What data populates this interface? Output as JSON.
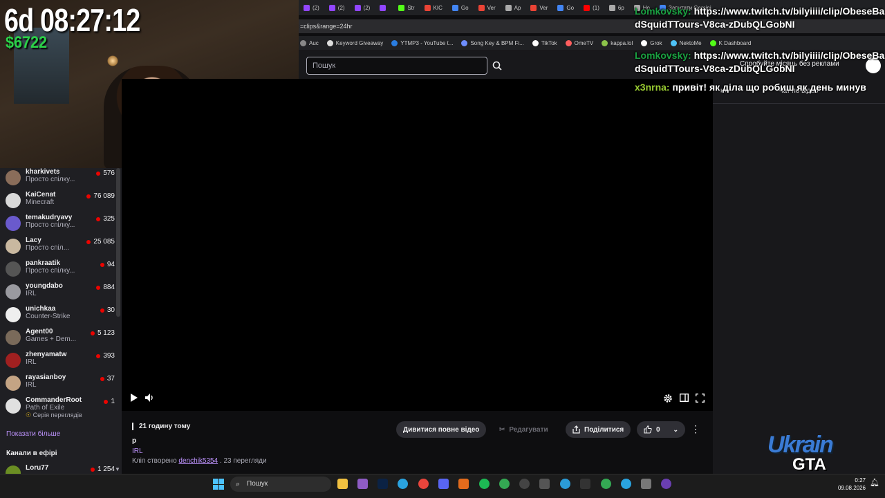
{
  "browser": {
    "tabs": [
      {
        "label": "(2)",
        "color": "#9146ff"
      },
      {
        "label": "(2)",
        "color": "#9146ff"
      },
      {
        "label": "(2)",
        "color": "#9146ff"
      },
      {
        "label": "",
        "color": "#9146ff"
      },
      {
        "label": "Str",
        "color": "#53fc18"
      },
      {
        "label": "KIC",
        "color": "#ea4335"
      },
      {
        "label": "Go",
        "color": "#4285f4"
      },
      {
        "label": "Ver",
        "color": "#ea4335"
      },
      {
        "label": "Ap",
        "color": "#aaaaaa"
      },
      {
        "label": "Ver",
        "color": "#ea4335"
      },
      {
        "label": "Go",
        "color": "#4285f4"
      },
      {
        "label": "(1)",
        "color": "#ff0000"
      },
      {
        "label": "6p",
        "color": "#aaaaaa"
      },
      {
        "label": "Ho",
        "color": "#aaaaaa"
      },
      {
        "label": "Запитати Gemini",
        "color": "#4285f4"
      }
    ],
    "address": "=clips&range=24hr",
    "bookmarks": [
      {
        "label": "Auc",
        "color": "#888888"
      },
      {
        "label": "Keyword Giveaway",
        "color": "#dddddd"
      },
      {
        "label": "YTMP3 - YouTube t...",
        "color": "#2a7de1"
      },
      {
        "label": "Song Key & BPM Fi...",
        "color": "#6e8eff"
      },
      {
        "label": "TikTok",
        "color": "#ffffff"
      },
      {
        "label": "OmeTV",
        "color": "#ff5e5e"
      },
      {
        "label": "kappa.lol",
        "color": "#8bc34a"
      },
      {
        "label": "Grok",
        "color": "#ffffff"
      },
      {
        "label": "NektoMe",
        "color": "#4fc3f7"
      },
      {
        "label": "K Dashboard",
        "color": "#53fc18"
      }
    ]
  },
  "nav": {
    "search_placeholder": "Пошук",
    "turbo_text": "Спробуйте місяць без реклами"
  },
  "webcam": {
    "timer": "6d 08:27:12",
    "money": "$6722"
  },
  "sidebar": {
    "channels": [
      {
        "name": "kharkivets",
        "game": "Просто спілку...",
        "viewers": "576",
        "color": "#8a6d5a"
      },
      {
        "name": "KaiCenat",
        "game": "Minecraft",
        "viewers": "76 089",
        "color": "#d9d9d9"
      },
      {
        "name": "temakudryavy",
        "game": "Просто спілку...",
        "viewers": "325",
        "color": "#6a5acd"
      },
      {
        "name": "Lacy",
        "game": "Просто спіл...",
        "viewers": "25 085",
        "color": "#c9b8a0"
      },
      {
        "name": "pankraatik",
        "game": "Просто спілку...",
        "viewers": "94",
        "color": "#555555"
      },
      {
        "name": "youngdabo",
        "game": "IRL",
        "viewers": "884",
        "color": "#9a9aa0"
      },
      {
        "name": "unichkaa",
        "game": "Counter-Strike",
        "viewers": "30",
        "color": "#eeeeee"
      },
      {
        "name": "Agent00",
        "game": "Games + Dem...",
        "viewers": "5 123",
        "color": "#7a6a5a"
      },
      {
        "name": "zhenyamatw",
        "game": "IRL",
        "viewers": "393",
        "color": "#a02020"
      },
      {
        "name": "rayasianboy",
        "game": "IRL",
        "viewers": "37",
        "color": "#c4a484"
      },
      {
        "name": "CommanderRoot",
        "game": "Path of Exile",
        "viewers": "1",
        "color": "#e0e0e0",
        "extra": "Серія переглядів 2"
      }
    ],
    "show_more": "Показати більше",
    "live_section_title": "Канали в ефірі",
    "live_channel": {
      "name": "Loru77",
      "viewers": "1 254",
      "color": "#6b8e23"
    }
  },
  "clip": {
    "time_ago": "21 годину тому",
    "title": "р",
    "category": "IRL",
    "created_prefix": "Кліп створено",
    "creator": "denchik5354",
    "views": ". 23 перегляди",
    "watch_full": "Дивитися повне відео",
    "edit": "Редагувати",
    "share": "Поділитися",
    "likes": "0"
  },
  "chat": {
    "title": "Чат по відео"
  },
  "overlay": {
    "messages": [
      {
        "user": "Lomkovsky:",
        "text": "https://www.twitch.tv/bilyiiii/clip/ObeseBa",
        "cont": "dSquidTTours-V8ca-zDubQLGobNI"
      },
      {
        "user": "Lomkovsky:",
        "text": "https://www.twitch.tv/bilyiiii/clip/ObeseBa",
        "cont": "dSquidTTours-V8ca-zDubQLGobNI"
      },
      {
        "user": "x3nrna:",
        "text": "привіт! як діла що робиш як день минув",
        "cont": ""
      }
    ]
  },
  "logo": {
    "top": "Ukrain",
    "bottom": "GTA"
  },
  "taskbar": {
    "search": "Пошук",
    "time": "0:27",
    "date": "09.08.2026"
  }
}
